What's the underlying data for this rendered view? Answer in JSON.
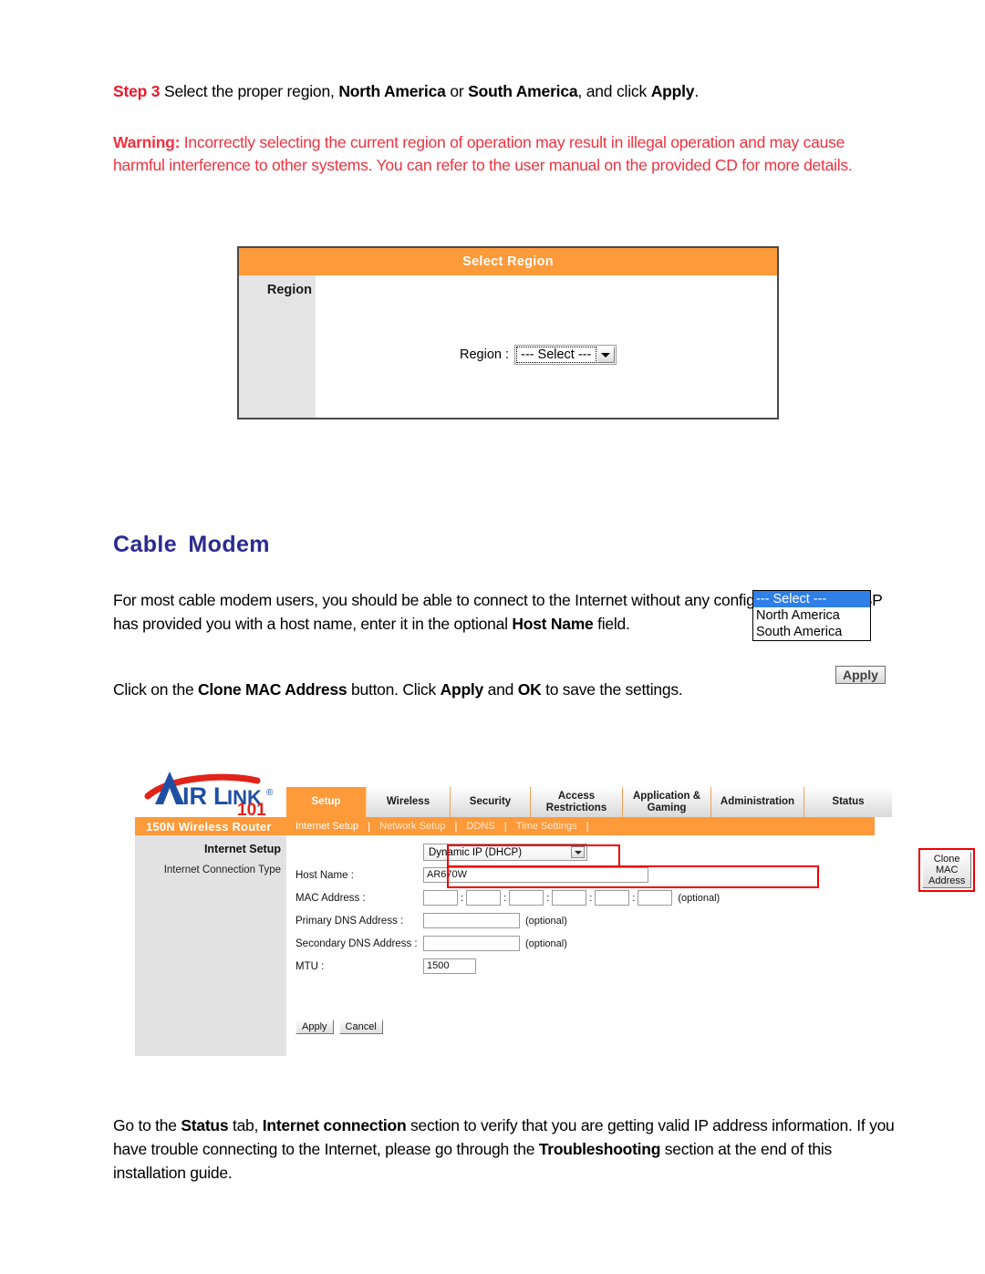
{
  "document": {
    "step": {
      "keyword": "Step 3",
      "text_1": " Select the proper region, ",
      "bold_1": "North America",
      "text_2": " or ",
      "bold_2": "South America",
      "text_3": ", and click ",
      "bold_3": "Apply",
      "text_4": "."
    },
    "warning": {
      "keyword": "Warning:",
      "text": " Incorrectly selecting the current region of operation may result in illegal operation and may cause harmful interference to other systems. You can refer to the user manual on the provided CD for more details."
    },
    "section_title": "Cable Modem",
    "paragraph_1": {
      "text_1": "For most cable modem users, you should be able to connect to the Internet without any configuration. If your ISP has provided you with a host name, enter it in the optional ",
      "bold_1": "Host Name",
      "text_2": " field."
    },
    "paragraph_2": {
      "text_1": "Click on the ",
      "bold_1": "Clone MAC Address",
      "text_2": " button. Click ",
      "bold_2": "Apply",
      "text_3": " and ",
      "bold_3": "OK",
      "text_4": " to save the settings."
    },
    "paragraph_3": {
      "text_1": "Go to the ",
      "bold_1": "Status",
      "text_2": " tab, ",
      "bold_2": "Internet connection",
      "text_3": " section to verify that you are getting valid IP address information.  If you have trouble connecting to the Internet, please go through the ",
      "bold_3": "Troubleshooting",
      "text_4": " section at the end of this installation guide."
    }
  },
  "select_region_panel": {
    "header_title": "Select Region",
    "sidebar_label": "Region",
    "field_label": "Region :",
    "selected_value": "--- Select ---",
    "dropdown_options": [
      {
        "label": "--- Select ---",
        "selected": true
      },
      {
        "label": "North America",
        "selected": false
      },
      {
        "label": "South America",
        "selected": false
      }
    ],
    "apply_label": "Apply"
  },
  "router_ui": {
    "logo": {
      "brand": "AIRLINK",
      "registered": "®",
      "model_number": "101"
    },
    "model_name": "150N Wireless Router",
    "tabs": [
      {
        "label": "Setup",
        "active": true
      },
      {
        "label": "Wireless",
        "active": false
      },
      {
        "label": "Security",
        "active": false
      },
      {
        "label": "Access Restrictions",
        "active": false
      },
      {
        "label": "Application & Gaming",
        "active": false
      },
      {
        "label": "Administration",
        "active": false
      },
      {
        "label": "Status",
        "active": false
      }
    ],
    "subnav": [
      {
        "label": "Internet Setup",
        "active": true
      },
      {
        "label": "Network Setup",
        "active": false
      },
      {
        "label": "DDNS",
        "active": false
      },
      {
        "label": "Time Settings",
        "active": false
      }
    ],
    "sidebar_title": "Internet Setup",
    "form": {
      "connection_type_label": "Internet Connection Type",
      "connection_type_value": "Dynamic IP (DHCP)",
      "host_name_label": "Host Name :",
      "host_name_value": "AR670W",
      "mac_address_label": "MAC Address :",
      "mac_octets": [
        "",
        "",
        "",
        "",
        "",
        ""
      ],
      "mac_optional": "(optional)",
      "clone_mac_label": "Clone MAC Address",
      "primary_dns_label": "Primary DNS Address :",
      "primary_dns_value": "",
      "primary_dns_optional": "(optional)",
      "secondary_dns_label": "Secondary DNS Address :",
      "secondary_dns_value": "",
      "secondary_dns_optional": "(optional)",
      "mtu_label": "MTU :",
      "mtu_value": "1500",
      "apply_label": "Apply",
      "cancel_label": "Cancel"
    }
  },
  "colors": {
    "orange": "#fd9a3a",
    "warning_red": "#ef3340",
    "step_red": "#e8192c",
    "heading_blue": "#2b2b8f",
    "highlight_red": "#ee0000",
    "panel_gray": "#e2e2e2",
    "select_highlight_blue": "#2f7fe8"
  }
}
